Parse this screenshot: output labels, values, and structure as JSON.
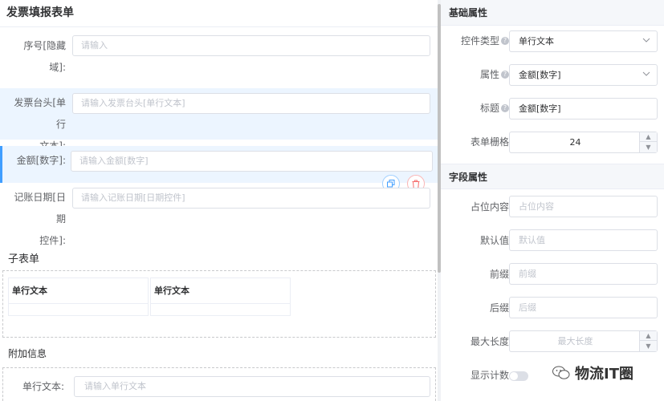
{
  "form": {
    "title": "发票填报表单",
    "fields": [
      {
        "label_line1": "序号[隐藏",
        "label_line2": "域]:",
        "placeholder": "请输入"
      },
      {
        "label_line1": "发票台头[单行",
        "label_line2": "文本]:",
        "placeholder": "请输入发票台头[单行文本]"
      },
      {
        "label": "金额[数字]:",
        "placeholder": "请输入金额[数字]"
      },
      {
        "label_line1": "记账日期[日期",
        "label_line2": "控件]:",
        "placeholder": "请输入记账日期[日期控件]"
      }
    ],
    "subform": {
      "title": "子表单",
      "columns": [
        "单行文本",
        "单行文本"
      ]
    },
    "extra": {
      "title": "附加信息",
      "field_label": "单行文本:",
      "field_placeholder": "请输入单行文本"
    }
  },
  "props": {
    "basic": {
      "title": "基础属性",
      "control_type_label": "控件类型",
      "control_type_value": "单行文本",
      "attribute_label": "属性",
      "attribute_value": "金额[数字]",
      "caption_label": "标题",
      "caption_value": "金额[数字]",
      "grid_label": "表单栅格",
      "grid_value": "24"
    },
    "field": {
      "title": "字段属性",
      "placeholder_label": "占位内容",
      "placeholder_value": "占位内容",
      "default_label": "默认值",
      "default_value": "默认值",
      "prefix_label": "前缀",
      "prefix_value": "前缀",
      "suffix_label": "后缀",
      "suffix_value": "后缀",
      "maxlen_label": "最大长度",
      "maxlen_value": "最大长度",
      "count_label": "显示计数"
    }
  },
  "watermark": "物流IT圈"
}
